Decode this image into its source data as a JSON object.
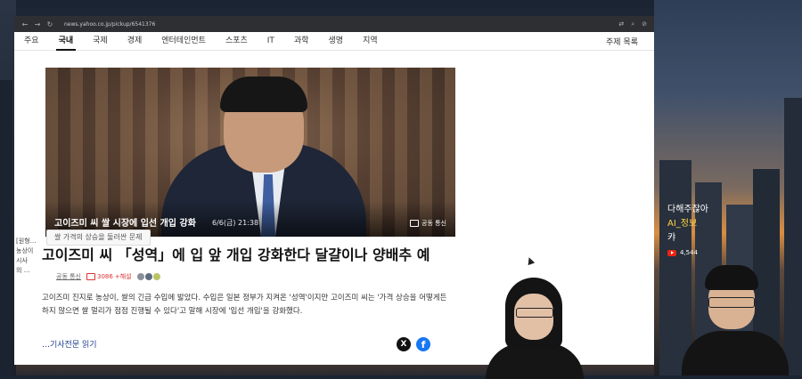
{
  "browser": {
    "url": "news.yahoo.co.jp/pickup/6541376"
  },
  "menu": {
    "items": [
      {
        "label": "주요",
        "active": false
      },
      {
        "label": "국내",
        "active": true
      },
      {
        "label": "국제",
        "active": false
      },
      {
        "label": "경제",
        "active": false
      },
      {
        "label": "엔터테인먼트",
        "active": false
      },
      {
        "label": "스포츠",
        "active": false
      },
      {
        "label": "IT",
        "active": false
      },
      {
        "label": "과학",
        "active": false
      },
      {
        "label": "생명",
        "active": false
      },
      {
        "label": "지역",
        "active": false
      }
    ],
    "right_label": "주제 목록"
  },
  "hero": {
    "caption": "고이즈미 씨 쌀 시장에 입선 개입 강화",
    "date": "6/6(금) 21:38",
    "credit": "공동 통신"
  },
  "sidebar_snippet": {
    "lines": [
      "[원형…",
      "농상이",
      "시사",
      "의 …"
    ]
  },
  "article": {
    "topic_tag": "쌀 가격의 상승을 둘러싼 문제",
    "headline": "고이즈미 씨 「성역」에 입 앞 개입 강화한다 달걀이나 양배추 예",
    "source": "공동 통신",
    "comments": "3086",
    "comments_suffix": "+해설",
    "body": "고이즈미 진지로 농상이, 쌀의 긴급 수입에 밟았다. 수입은 일본 정부가 지켜온 '성역'이지만 고이즈미 씨는 '가격 상승을 어떻게든 하지 않으면 쌀 멀리가 점점 진행될 수 있다'고 말해 시장에 '입선 개입'을 강화했다.",
    "read_more": "…기사전문 읽기"
  },
  "overlay": {
    "line1": "다해주잖아",
    "line2": "AI_정보",
    "line3": "캬",
    "yt_count": "4,544"
  },
  "colors": {
    "accent_link": "#1b3a8a",
    "comment_red": "#dd3333",
    "facebook_blue": "#1877f2"
  }
}
